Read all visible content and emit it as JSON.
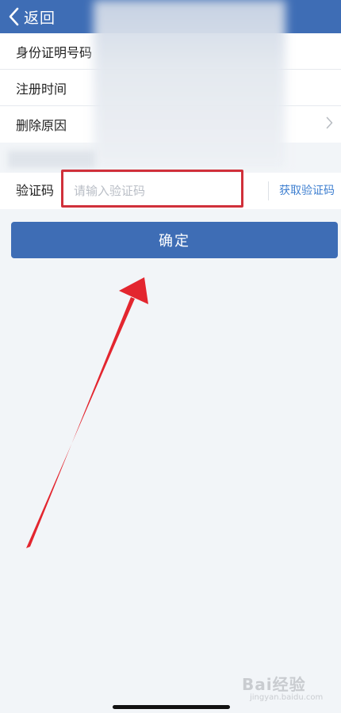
{
  "header": {
    "back_label": "返回",
    "background": "#3e6db5"
  },
  "info_rows": [
    {
      "label": "身份证明号码"
    },
    {
      "label": "注册时间"
    },
    {
      "label": "删除原因"
    }
  ],
  "verify": {
    "label": "验证码",
    "input_placeholder": "请输入验证码",
    "input_value": "",
    "get_code_label": "获取验证码",
    "link_color": "#3e7fd0",
    "highlight_color": "#d0303a"
  },
  "confirm": {
    "label": "确定"
  },
  "watermark": {
    "main": "Bai经验",
    "sub": "jingyan.baidu.com"
  },
  "icons": {
    "back": "chevron-left-icon",
    "row_arrow": "chevron-right-icon",
    "annotation": "red-arrow-icon"
  },
  "colors": {
    "accent": "#3e6db5",
    "page_background": "#f2f5f8",
    "annotation_arrow": "#e3262f"
  }
}
